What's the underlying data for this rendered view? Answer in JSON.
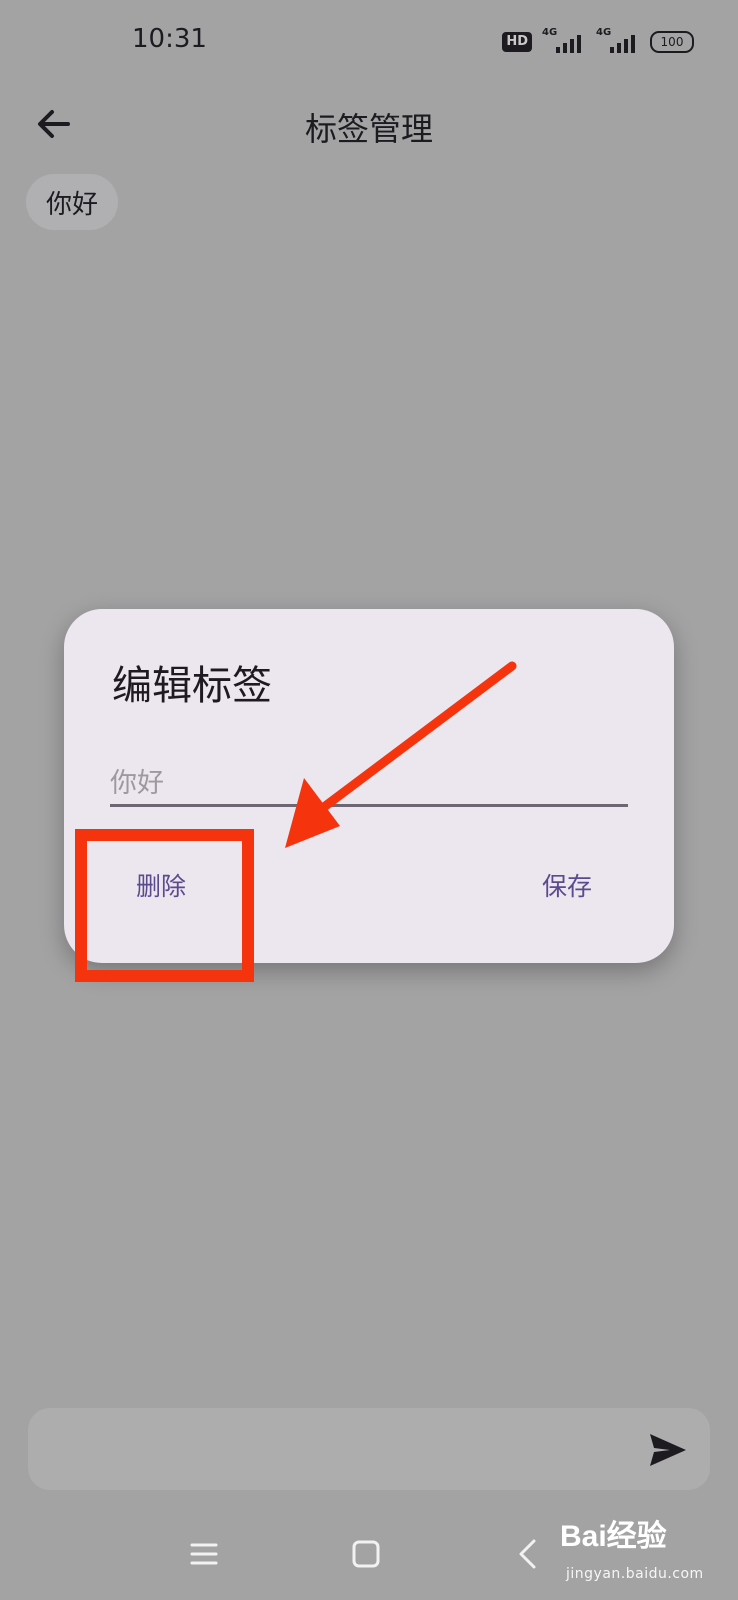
{
  "status_bar": {
    "time": "10:31",
    "hd_label": "HD",
    "net1": "4G",
    "net2": "4G",
    "battery": "100"
  },
  "app_bar": {
    "title": "标签管理",
    "back_icon": "arrow-left-icon"
  },
  "tags": [
    {
      "label": "你好"
    }
  ],
  "dialog": {
    "title": "编辑标签",
    "input_value": "你好",
    "delete_label": "删除",
    "save_label": "保存"
  },
  "composer": {
    "send_icon": "send-icon"
  },
  "nav_bar": {
    "menu_icon": "menu-icon",
    "home_icon": "home-square-icon",
    "back_icon": "chevron-left-icon"
  },
  "watermark": {
    "brand": "Bai经验",
    "url": "jingyan.baidu.com"
  },
  "colors": {
    "scrim": "#a3a3a4",
    "dialog_bg": "#ece6ee",
    "accent": "#5b4a8e",
    "annotation": "#f5340e"
  }
}
